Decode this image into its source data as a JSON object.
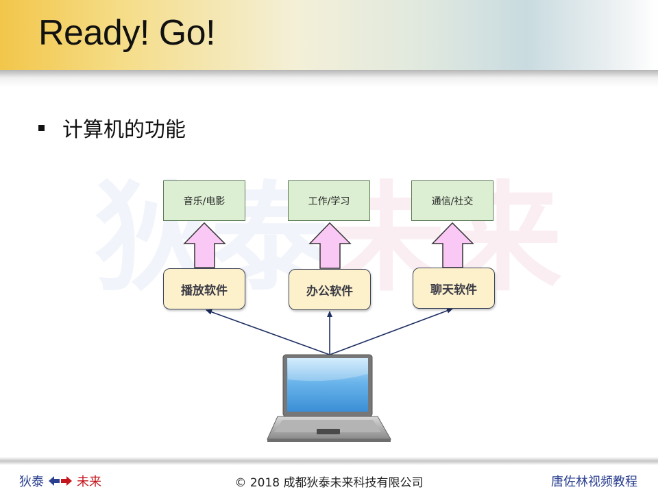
{
  "slide": {
    "title": "Ready! Go!",
    "bullet": "计算机的功能"
  },
  "watermark": {
    "part1": "狄泰",
    "part2": "未来"
  },
  "diagram": {
    "top_boxes": [
      "音乐/电影",
      "工作/学习",
      "通信/社交"
    ],
    "app_boxes": [
      "播放软件",
      "办公软件",
      "聊天软件"
    ],
    "device": "laptop-icon"
  },
  "footer": {
    "left_a": "狄泰",
    "left_b": "未来",
    "center": "© 2018 成都狄泰未来科技有限公司",
    "right": "唐佐林视频教程"
  },
  "colors": {
    "title_band": "#f2c64a",
    "top_box_fill": "#dcefd3",
    "app_box_fill": "#fdf1cc",
    "up_arrow_fill": "#fac8f5",
    "connector": "#1f2f63",
    "footer_blue": "#2a3f8f",
    "footer_red": "#c4161c"
  }
}
